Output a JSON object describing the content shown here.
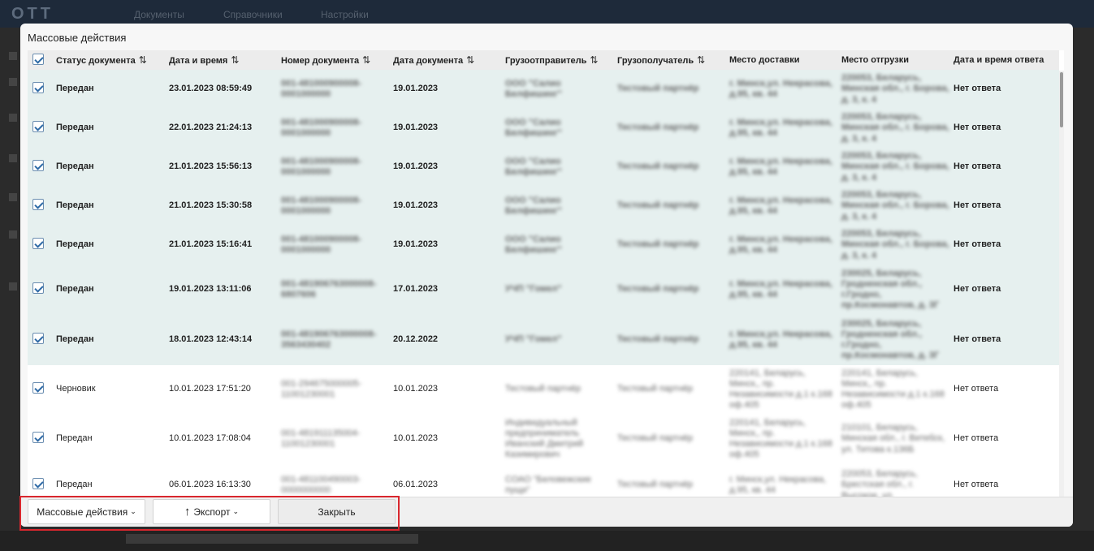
{
  "modal": {
    "title": "Массовые действия"
  },
  "table": {
    "columns": [
      {
        "label": "Статус документа",
        "sortable": true
      },
      {
        "label": "Дата и время",
        "sortable": true
      },
      {
        "label": "Номер документа",
        "sortable": true
      },
      {
        "label": "Дата документа",
        "sortable": true
      },
      {
        "label": "Грузоотправитель",
        "sortable": true
      },
      {
        "label": "Грузополучатель",
        "sortable": true
      },
      {
        "label": "Место доставки",
        "sortable": false
      },
      {
        "label": "Место отгрузки",
        "sortable": false
      },
      {
        "label": "Дата и время ответа",
        "sortable": false
      }
    ],
    "sort_glyph": "⇅",
    "rows": [
      {
        "status": "Передан",
        "datetime": "23.01.2023 08:59:49",
        "doc_number": "001-481000900008-0001000000",
        "doc_date": "19.01.2023",
        "shipper": "ООО \"Салио Белфишинг\"",
        "consignee": "Тестовый партнёр",
        "delivery": "г. Минск,ул. Некрасова, д.95, кв. 44",
        "shipping": "220053, Беларусь, Минская обл., г. Борова, д. 3, к. 4",
        "response": "Нет ответа"
      },
      {
        "status": "Передан",
        "datetime": "22.01.2023 21:24:13",
        "doc_number": "001-481000900008-0001000000",
        "doc_date": "19.01.2023",
        "shipper": "ООО \"Салио Белфишинг\"",
        "consignee": "Тестовый партнёр",
        "delivery": "г. Минск,ул. Некрасова, д.95, кв. 44",
        "shipping": "220053, Беларусь, Минская обл., г. Борова, д. 3, к. 4",
        "response": "Нет ответа"
      },
      {
        "status": "Передан",
        "datetime": "21.01.2023 15:56:13",
        "doc_number": "001-481000900008-0001000000",
        "doc_date": "19.01.2023",
        "shipper": "ООО \"Салио Белфишинг\"",
        "consignee": "Тестовый партнёр",
        "delivery": "г. Минск,ул. Некрасова, д.95, кв. 44",
        "shipping": "220053, Беларусь, Минская обл., г. Борова, д. 3, к. 4",
        "response": "Нет ответа"
      },
      {
        "status": "Передан",
        "datetime": "21.01.2023 15:30:58",
        "doc_number": "001-481000900008-0001000000",
        "doc_date": "19.01.2023",
        "shipper": "ООО \"Салио Белфишинг\"",
        "consignee": "Тестовый партнёр",
        "delivery": "г. Минск,ул. Некрасова, д.95, кв. 44",
        "shipping": "220053, Беларусь, Минская обл., г. Борова, д. 3, к. 4",
        "response": "Нет ответа"
      },
      {
        "status": "Передан",
        "datetime": "21.01.2023 15:16:41",
        "doc_number": "001-481000900008-0001000000",
        "doc_date": "19.01.2023",
        "shipper": "ООО \"Салио Белфишинг\"",
        "consignee": "Тестовый партнёр",
        "delivery": "г. Минск,ул. Некрасова, д.95, кв. 44",
        "shipping": "220053, Беларусь, Минская обл., г. Борова, д. 3, к. 4",
        "response": "Нет ответа"
      },
      {
        "status": "Передан",
        "datetime": "19.01.2023 13:11:06",
        "doc_number": "001-481906763000008-6807606",
        "doc_date": "17.01.2023",
        "shipper": "УЧП \"Гомел\"",
        "consignee": "Тестовый партнёр",
        "delivery": "г. Минск,ул. Некрасова, д.95, кв. 44",
        "shipping": "230025, Беларусь, Гродненская обл., г.Гродно, пр.Космонавтов, д. 3Г",
        "response": "Нет ответа"
      },
      {
        "status": "Передан",
        "datetime": "18.01.2023 12:43:14",
        "doc_number": "001-481906763000008-3563430402",
        "doc_date": "20.12.2022",
        "shipper": "УЧП \"Гомел\"",
        "consignee": "Тестовый партнёр",
        "delivery": "г. Минск,ул. Некрасова, д.95, кв. 44",
        "shipping": "230025, Беларусь, Гродненская обл., г.Гродно, пр.Космонавтов, д. 3Г",
        "response": "Нет ответа"
      },
      {
        "status": "Черновик",
        "datetime": "10.01.2023 17:51:20",
        "doc_number": "001-294675000005-11001230001",
        "doc_date": "10.01.2023",
        "shipper": "Тестовый партнёр",
        "consignee": "Тестовый партнёр",
        "delivery": "220141, Беларусь, Минск,, пр. Независимости д.1 к.168 оф.405",
        "shipping": "220141, Беларусь, Минск,, пр. Независимости д.1 к.168 оф.405",
        "response": "Нет ответа"
      },
      {
        "status": "Передан",
        "datetime": "10.01.2023 17:08:04",
        "doc_number": "001-481911135004-11001230001",
        "doc_date": "10.01.2023",
        "shipper": "Индивидуальный предприниматель Иванский Дмитрий Казимирович",
        "consignee": "Тестовый партнёр",
        "delivery": "220141, Беларусь, Минск,, пр. Независимости д.1 к.168 оф.405",
        "shipping": "210101, Беларусь, Минская обл., г. Витебск, ул. Титова к.136Б",
        "response": "Нет ответа"
      },
      {
        "status": "Передан",
        "datetime": "06.01.2023 16:13:30",
        "doc_number": "001-481100490003-0000000000",
        "doc_date": "06.01.2023",
        "shipper": "СОАО \"Беловежские пущи\"",
        "consignee": "Тестовый партнёр",
        "delivery": "г. Минск,ул. Некрасова, д.95, кв. 44",
        "shipping": "220053, Беларусь, Брестская обл., г. Высокое, ул.",
        "response": "Нет ответа"
      }
    ]
  },
  "footer": {
    "mass_actions_label": "Массовые действия",
    "export_label": "Экспорт",
    "close_label": "Закрыть",
    "chevron_glyph": "⌄",
    "arrow_glyph": "↑"
  },
  "background": {
    "menu": [
      "Документы",
      "Справочники",
      "Настройки"
    ]
  }
}
